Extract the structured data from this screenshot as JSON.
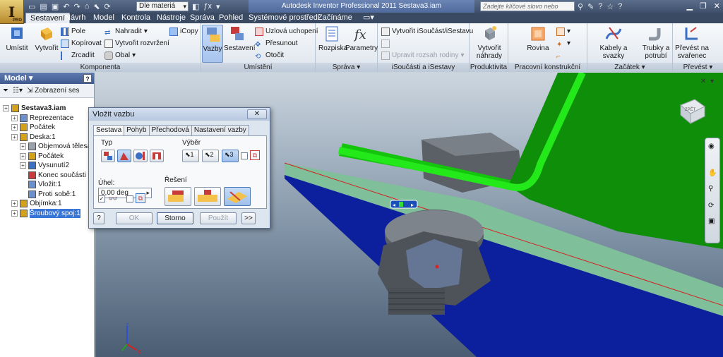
{
  "app": {
    "title": "Autodesk Inventor Professional 2011   Sestava3.iam",
    "material": "Dle materiá",
    "search_placeholder": "Zadejte klíčové slovo nebo výraz.",
    "logo_letter": "I",
    "logo_badge": "PRO"
  },
  "tabs": [
    "Sestavení",
    "Návrh",
    "Model",
    "Kontrola",
    "Nástroje",
    "Správa",
    "Pohled",
    "Systémové prostředí",
    "Začínáme"
  ],
  "ribbon": {
    "komponenta": {
      "title": "Komponenta",
      "umistit": "Umístit",
      "vytvorit": "Vytvořit",
      "pole": "Pole",
      "kopirovat": "Kopírovat",
      "zrcadlit": "Zrcadlit",
      "nahradit": "Nahradit",
      "vytvorit_rozvrzeni": "Vytvořit rozvržení",
      "obal": "Obal",
      "icopy": "iCopy"
    },
    "umisteni": {
      "title": "Umístění",
      "vazby": "Vazby",
      "sestaveni": "Sestavení",
      "uzlova": "Uzlová uchopení",
      "presunout": "Přesunout",
      "otocit": "Otočit"
    },
    "sprava": {
      "title": "Správa",
      "rozpiska": "Rozpiska",
      "parametry": "Parametry"
    },
    "isoucasti": {
      "title": "iSoučásti a iSestavy",
      "vytvorit": "Vytvořit iSoučást/iSestavu",
      "upravit": "Upravit rozsah rodiny"
    },
    "produktivita": {
      "title": "Produktivita",
      "vytvorit_nahrady": "Vytvořit náhrady"
    },
    "pracovni": {
      "title": "Pracovní konstrukční prvky",
      "rovina": "Rovina"
    },
    "zacatek": {
      "title": "Začátek",
      "kabely": "Kabely a svazky",
      "trubky": "Trubky a potrubí"
    },
    "prevest": {
      "title": "Převést",
      "prevest_na": "Převést na svařenec"
    }
  },
  "browser": {
    "title": "Model",
    "zobrazeni": "Zobrazení ses",
    "items": [
      {
        "label": "Sestava3.iam",
        "level": 0,
        "bold": true
      },
      {
        "label": "Reprezentace",
        "level": 1
      },
      {
        "label": "Počátek",
        "level": 1
      },
      {
        "label": "Deska:1",
        "level": 1
      },
      {
        "label": "Objemová tělesa(1)",
        "level": 2
      },
      {
        "label": "Počátek",
        "level": 2
      },
      {
        "label": "Vysunutí2",
        "level": 2
      },
      {
        "label": "Konec součásti",
        "level": 2
      },
      {
        "label": "Vložit:1",
        "level": 2
      },
      {
        "label": "Proti sobě:1",
        "level": 2
      },
      {
        "label": "Objímka:1",
        "level": 1
      },
      {
        "label": "Šroubový spoj:1",
        "level": 1,
        "selected": true
      }
    ]
  },
  "dialog": {
    "title": "Vložit vazbu",
    "close": "✕",
    "tabs": [
      "Sestava",
      "Pohyb",
      "Přechodová",
      "Nastavení vazby"
    ],
    "typ_label": "Typ",
    "vyber_label": "Výběr",
    "uhel_label": "Úhel:",
    "uhel_value": "0,00 deg",
    "reseni_label": "Řešení",
    "ok": "OK",
    "storno": "Storno",
    "pouzit": "Použít",
    "more": ">>",
    "help": "?",
    "sel1": "1",
    "sel2": "2",
    "sel3": "3"
  },
  "viewport": {
    "axis_z": "z",
    "axis_x": "x",
    "viewcube_label": "ZPĚT"
  },
  "colors": {
    "bracket": "#17d40f",
    "plate_top": "#7fbf9a",
    "plate_bottom": "#0c1f9c",
    "bolt": "#5b6067"
  }
}
